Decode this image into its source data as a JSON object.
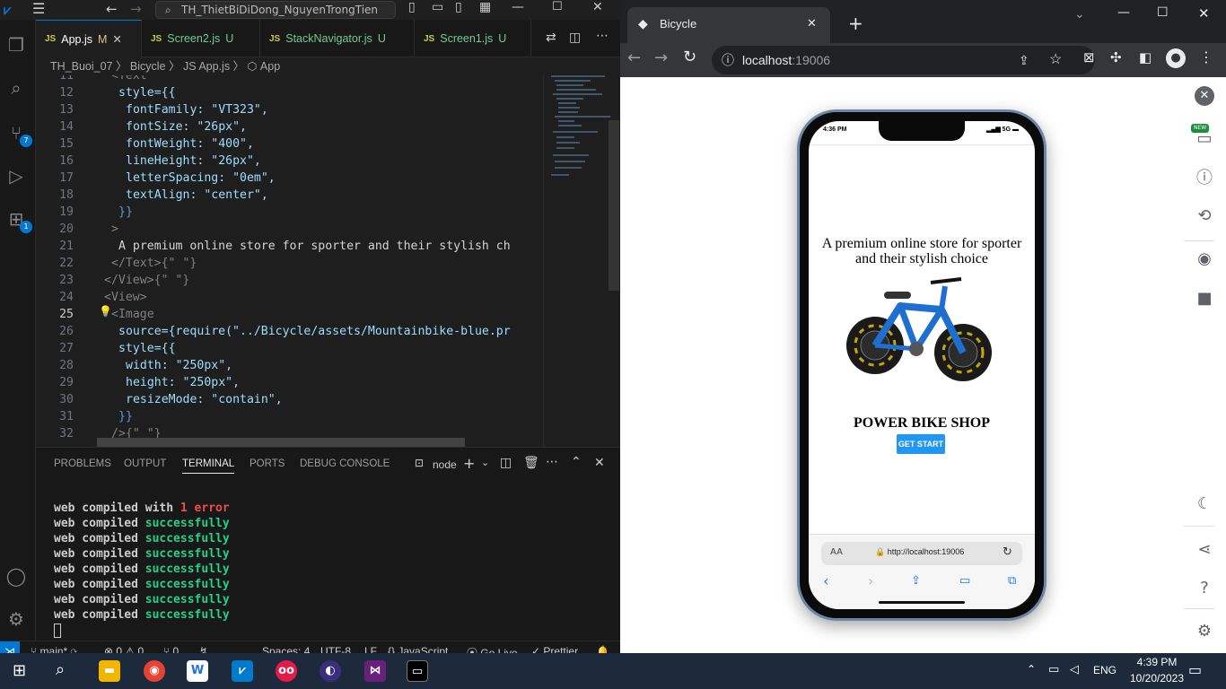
{
  "vscode": {
    "search": "TH_ThietBiDiDong_NguyenTrongTien",
    "tabs": [
      {
        "label": "App.js",
        "status": "M",
        "active": true
      },
      {
        "label": "Screen2.js",
        "status": "U"
      },
      {
        "label": "StackNavigator.js",
        "status": "U"
      },
      {
        "label": "Screen1.js",
        "status": "U"
      }
    ],
    "breadcrumb": "TH_Buoi_07 〉 Bicycle 〉 JS App.js 〉 ⬡ App",
    "badges": {
      "scm": "7",
      "extensions": "1"
    },
    "code_lines": [
      {
        "n": "11",
        "t": "<Text"
      },
      {
        "n": "12",
        "t": "style={{"
      },
      {
        "n": "13",
        "t": "fontFamily: \"VT323\","
      },
      {
        "n": "14",
        "t": "fontSize: \"26px\","
      },
      {
        "n": "15",
        "t": "fontWeight: \"400\","
      },
      {
        "n": "16",
        "t": "lineHeight: \"26px\","
      },
      {
        "n": "17",
        "t": "letterSpacing: \"0em\","
      },
      {
        "n": "18",
        "t": "textAlign: \"center\","
      },
      {
        "n": "19",
        "t": "}}"
      },
      {
        "n": "20",
        "t": ">"
      },
      {
        "n": "21",
        "t": "A premium online store for sporter and their stylish ch"
      },
      {
        "n": "22",
        "t": "</Text>{\" \"}"
      },
      {
        "n": "23",
        "t": "</View>{\" \"}"
      },
      {
        "n": "24",
        "t": "<View>"
      },
      {
        "n": "25",
        "t": "<Image"
      },
      {
        "n": "26",
        "t": "source={require(\"../Bicycle/assets/Mountainbike-blue.pr"
      },
      {
        "n": "27",
        "t": "style={{"
      },
      {
        "n": "28",
        "t": "width: \"250px\","
      },
      {
        "n": "29",
        "t": "height: \"250px\","
      },
      {
        "n": "30",
        "t": "resizeMode: \"contain\","
      },
      {
        "n": "31",
        "t": "}}"
      },
      {
        "n": "32",
        "t": "/>{\" \"}"
      }
    ],
    "panel_tabs": [
      "PROBLEMS",
      "OUTPUT",
      "TERMINAL",
      "PORTS",
      "DEBUG CONSOLE"
    ],
    "terminal_name": "node",
    "terminal_lines": [
      {
        "prefix": "web compiled with ",
        "hl": "1 error",
        "kind": "error"
      },
      {
        "prefix": "web compiled ",
        "hl": "successfully",
        "kind": "ok"
      },
      {
        "prefix": "web compiled ",
        "hl": "successfully",
        "kind": "ok"
      },
      {
        "prefix": "web compiled ",
        "hl": "successfully",
        "kind": "ok"
      },
      {
        "prefix": "web compiled ",
        "hl": "successfully",
        "kind": "ok"
      },
      {
        "prefix": "web compiled ",
        "hl": "successfully",
        "kind": "ok"
      },
      {
        "prefix": "web compiled ",
        "hl": "successfully",
        "kind": "ok"
      },
      {
        "prefix": "web compiled ",
        "hl": "successfully",
        "kind": "ok"
      }
    ],
    "status": {
      "branch": "main*",
      "problems": "⊗ 0 ⚠ 0",
      "ports": "⑂ 0",
      "spaces": "Spaces: 4",
      "encoding": "UTF-8",
      "eol": "LF",
      "language": "{} JavaScript",
      "golive": "Go Live",
      "prettier": "✓ Prettier"
    }
  },
  "chrome": {
    "tab_title": "Bicycle",
    "url_host": "localhost",
    "url_port": ":19006"
  },
  "phone": {
    "time": "4:36 PM",
    "signal": "5G",
    "tagline": "A premium online store for sporter and their stylish choice",
    "shop_name": "POWER BIKE SHOP",
    "button": "GET START",
    "safari_aa": "AA",
    "safari_url": "http://localhost:19006",
    "new_badge": "NEW"
  },
  "taskbar": {
    "lang": "ENG",
    "time": "4:39 PM",
    "date": "10/20/2023"
  }
}
